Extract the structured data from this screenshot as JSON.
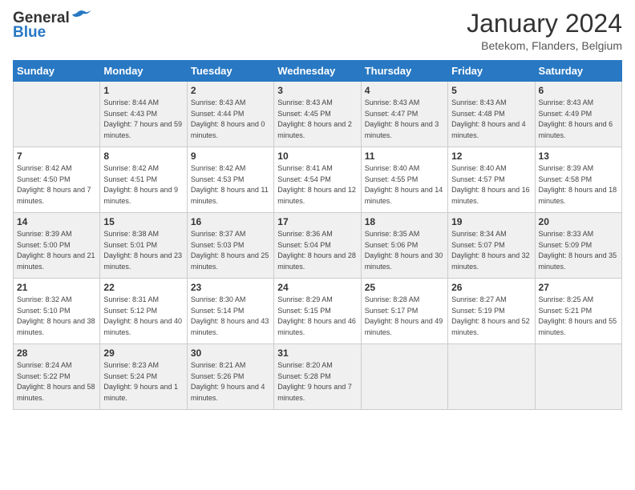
{
  "header": {
    "logo_line1": "General",
    "logo_line2": "Blue",
    "month_title": "January 2024",
    "location": "Betekom, Flanders, Belgium"
  },
  "weekdays": [
    "Sunday",
    "Monday",
    "Tuesday",
    "Wednesday",
    "Thursday",
    "Friday",
    "Saturday"
  ],
  "weeks": [
    [
      {
        "day": "",
        "sunrise": "",
        "sunset": "",
        "daylight": ""
      },
      {
        "day": "1",
        "sunrise": "Sunrise: 8:44 AM",
        "sunset": "Sunset: 4:43 PM",
        "daylight": "Daylight: 7 hours and 59 minutes."
      },
      {
        "day": "2",
        "sunrise": "Sunrise: 8:43 AM",
        "sunset": "Sunset: 4:44 PM",
        "daylight": "Daylight: 8 hours and 0 minutes."
      },
      {
        "day": "3",
        "sunrise": "Sunrise: 8:43 AM",
        "sunset": "Sunset: 4:45 PM",
        "daylight": "Daylight: 8 hours and 2 minutes."
      },
      {
        "day": "4",
        "sunrise": "Sunrise: 8:43 AM",
        "sunset": "Sunset: 4:47 PM",
        "daylight": "Daylight: 8 hours and 3 minutes."
      },
      {
        "day": "5",
        "sunrise": "Sunrise: 8:43 AM",
        "sunset": "Sunset: 4:48 PM",
        "daylight": "Daylight: 8 hours and 4 minutes."
      },
      {
        "day": "6",
        "sunrise": "Sunrise: 8:43 AM",
        "sunset": "Sunset: 4:49 PM",
        "daylight": "Daylight: 8 hours and 6 minutes."
      }
    ],
    [
      {
        "day": "7",
        "sunrise": "Sunrise: 8:42 AM",
        "sunset": "Sunset: 4:50 PM",
        "daylight": "Daylight: 8 hours and 7 minutes."
      },
      {
        "day": "8",
        "sunrise": "Sunrise: 8:42 AM",
        "sunset": "Sunset: 4:51 PM",
        "daylight": "Daylight: 8 hours and 9 minutes."
      },
      {
        "day": "9",
        "sunrise": "Sunrise: 8:42 AM",
        "sunset": "Sunset: 4:53 PM",
        "daylight": "Daylight: 8 hours and 11 minutes."
      },
      {
        "day": "10",
        "sunrise": "Sunrise: 8:41 AM",
        "sunset": "Sunset: 4:54 PM",
        "daylight": "Daylight: 8 hours and 12 minutes."
      },
      {
        "day": "11",
        "sunrise": "Sunrise: 8:40 AM",
        "sunset": "Sunset: 4:55 PM",
        "daylight": "Daylight: 8 hours and 14 minutes."
      },
      {
        "day": "12",
        "sunrise": "Sunrise: 8:40 AM",
        "sunset": "Sunset: 4:57 PM",
        "daylight": "Daylight: 8 hours and 16 minutes."
      },
      {
        "day": "13",
        "sunrise": "Sunrise: 8:39 AM",
        "sunset": "Sunset: 4:58 PM",
        "daylight": "Daylight: 8 hours and 18 minutes."
      }
    ],
    [
      {
        "day": "14",
        "sunrise": "Sunrise: 8:39 AM",
        "sunset": "Sunset: 5:00 PM",
        "daylight": "Daylight: 8 hours and 21 minutes."
      },
      {
        "day": "15",
        "sunrise": "Sunrise: 8:38 AM",
        "sunset": "Sunset: 5:01 PM",
        "daylight": "Daylight: 8 hours and 23 minutes."
      },
      {
        "day": "16",
        "sunrise": "Sunrise: 8:37 AM",
        "sunset": "Sunset: 5:03 PM",
        "daylight": "Daylight: 8 hours and 25 minutes."
      },
      {
        "day": "17",
        "sunrise": "Sunrise: 8:36 AM",
        "sunset": "Sunset: 5:04 PM",
        "daylight": "Daylight: 8 hours and 28 minutes."
      },
      {
        "day": "18",
        "sunrise": "Sunrise: 8:35 AM",
        "sunset": "Sunset: 5:06 PM",
        "daylight": "Daylight: 8 hours and 30 minutes."
      },
      {
        "day": "19",
        "sunrise": "Sunrise: 8:34 AM",
        "sunset": "Sunset: 5:07 PM",
        "daylight": "Daylight: 8 hours and 32 minutes."
      },
      {
        "day": "20",
        "sunrise": "Sunrise: 8:33 AM",
        "sunset": "Sunset: 5:09 PM",
        "daylight": "Daylight: 8 hours and 35 minutes."
      }
    ],
    [
      {
        "day": "21",
        "sunrise": "Sunrise: 8:32 AM",
        "sunset": "Sunset: 5:10 PM",
        "daylight": "Daylight: 8 hours and 38 minutes."
      },
      {
        "day": "22",
        "sunrise": "Sunrise: 8:31 AM",
        "sunset": "Sunset: 5:12 PM",
        "daylight": "Daylight: 8 hours and 40 minutes."
      },
      {
        "day": "23",
        "sunrise": "Sunrise: 8:30 AM",
        "sunset": "Sunset: 5:14 PM",
        "daylight": "Daylight: 8 hours and 43 minutes."
      },
      {
        "day": "24",
        "sunrise": "Sunrise: 8:29 AM",
        "sunset": "Sunset: 5:15 PM",
        "daylight": "Daylight: 8 hours and 46 minutes."
      },
      {
        "day": "25",
        "sunrise": "Sunrise: 8:28 AM",
        "sunset": "Sunset: 5:17 PM",
        "daylight": "Daylight: 8 hours and 49 minutes."
      },
      {
        "day": "26",
        "sunrise": "Sunrise: 8:27 AM",
        "sunset": "Sunset: 5:19 PM",
        "daylight": "Daylight: 8 hours and 52 minutes."
      },
      {
        "day": "27",
        "sunrise": "Sunrise: 8:25 AM",
        "sunset": "Sunset: 5:21 PM",
        "daylight": "Daylight: 8 hours and 55 minutes."
      }
    ],
    [
      {
        "day": "28",
        "sunrise": "Sunrise: 8:24 AM",
        "sunset": "Sunset: 5:22 PM",
        "daylight": "Daylight: 8 hours and 58 minutes."
      },
      {
        "day": "29",
        "sunrise": "Sunrise: 8:23 AM",
        "sunset": "Sunset: 5:24 PM",
        "daylight": "Daylight: 9 hours and 1 minute."
      },
      {
        "day": "30",
        "sunrise": "Sunrise: 8:21 AM",
        "sunset": "Sunset: 5:26 PM",
        "daylight": "Daylight: 9 hours and 4 minutes."
      },
      {
        "day": "31",
        "sunrise": "Sunrise: 8:20 AM",
        "sunset": "Sunset: 5:28 PM",
        "daylight": "Daylight: 9 hours and 7 minutes."
      },
      {
        "day": "",
        "sunrise": "",
        "sunset": "",
        "daylight": ""
      },
      {
        "day": "",
        "sunrise": "",
        "sunset": "",
        "daylight": ""
      },
      {
        "day": "",
        "sunrise": "",
        "sunset": "",
        "daylight": ""
      }
    ]
  ]
}
